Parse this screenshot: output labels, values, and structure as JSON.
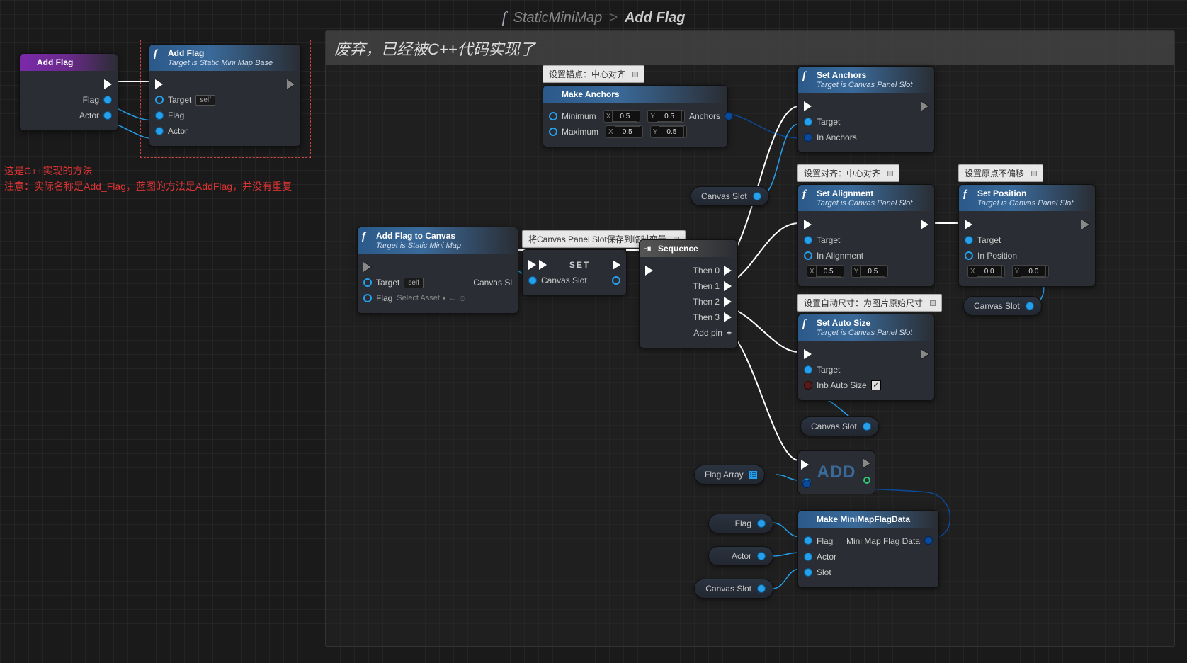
{
  "breadcrumb": {
    "icon": "f",
    "parent": "StaticMiniMap",
    "chevron": ">",
    "current": "Add Flag"
  },
  "comment": {
    "text": "废弃，已经被C++代码实现了"
  },
  "redtext": {
    "line1": "这是C++实现的方法",
    "line2": "注意：实际名称是Add_Flag，蓝图的方法是AddFlag，并没有重复"
  },
  "tooltips": {
    "anchor": "设置锚点：中心对齐",
    "canvasSlotSave": "将Canvas Panel Slot保存到临时变量",
    "alignment": "设置对齐：中心对齐",
    "position": "设置原点不偏移",
    "autosize": "设置自动尺寸：为图片原始尺寸"
  },
  "nodes": {
    "addFlagFn": {
      "title": "Add Flag",
      "pinFlag": "Flag",
      "pinActor": "Actor"
    },
    "addFlagCall": {
      "title": "Add Flag",
      "subtitle": "Target is Static Mini Map Base",
      "target": "Target",
      "self": "self",
      "flag": "Flag",
      "actor": "Actor"
    },
    "makeAnchors": {
      "title": "Make Anchors",
      "minimum": "Minimum",
      "maximum": "Maximum",
      "minX": "0.5",
      "minY": "0.5",
      "maxX": "0.5",
      "maxY": "0.5",
      "anchors": "Anchors"
    },
    "setAnchors": {
      "title": "Set Anchors",
      "subtitle": "Target is Canvas Panel Slot",
      "target": "Target",
      "inAnchors": "In Anchors"
    },
    "setAlignment": {
      "title": "Set Alignment",
      "subtitle": "Target is Canvas Panel Slot",
      "target": "Target",
      "inAlign": "In Alignment",
      "x": "0.5",
      "y": "0.5"
    },
    "setPosition": {
      "title": "Set Position",
      "subtitle": "Target is Canvas Panel Slot",
      "target": "Target",
      "inPos": "In Position",
      "x": "0.0",
      "y": "0.0"
    },
    "setAutoSize": {
      "title": "Set Auto Size",
      "subtitle": "Target is Canvas Panel Slot",
      "target": "Target",
      "inAuto": "Inb Auto Size",
      "checked": "✓"
    },
    "addToCanvas": {
      "title": "Add Flag to Canvas",
      "subtitle": "Target is Static Mini Map",
      "target": "Target",
      "self": "self",
      "flag": "Flag",
      "selectAsset": "Select Asset",
      "canvasSlotL": "Canvas Sl",
      "canvasSlotR": "Canvas Slot"
    },
    "set": {
      "title": "SET"
    },
    "sequence": {
      "title": "Sequence",
      "then0": "Then 0",
      "then1": "Then 1",
      "then2": "Then 2",
      "then3": "Then 3",
      "addPin": "Add pin"
    },
    "makeFlagData": {
      "title": "Make MiniMapFlagData",
      "flag": "Flag",
      "actor": "Actor",
      "slot": "Slot",
      "out": "Mini Map Flag Data"
    },
    "addArr": {
      "label": "ADD"
    }
  },
  "varNodes": {
    "canvasSlot1": "Canvas Slot",
    "canvasSlot2": "Canvas Slot",
    "canvasSlot3": "Canvas Slot",
    "canvasSlot4": "Canvas Slot",
    "flagArray": "Flag Array",
    "flag": "Flag",
    "actor": "Actor"
  }
}
